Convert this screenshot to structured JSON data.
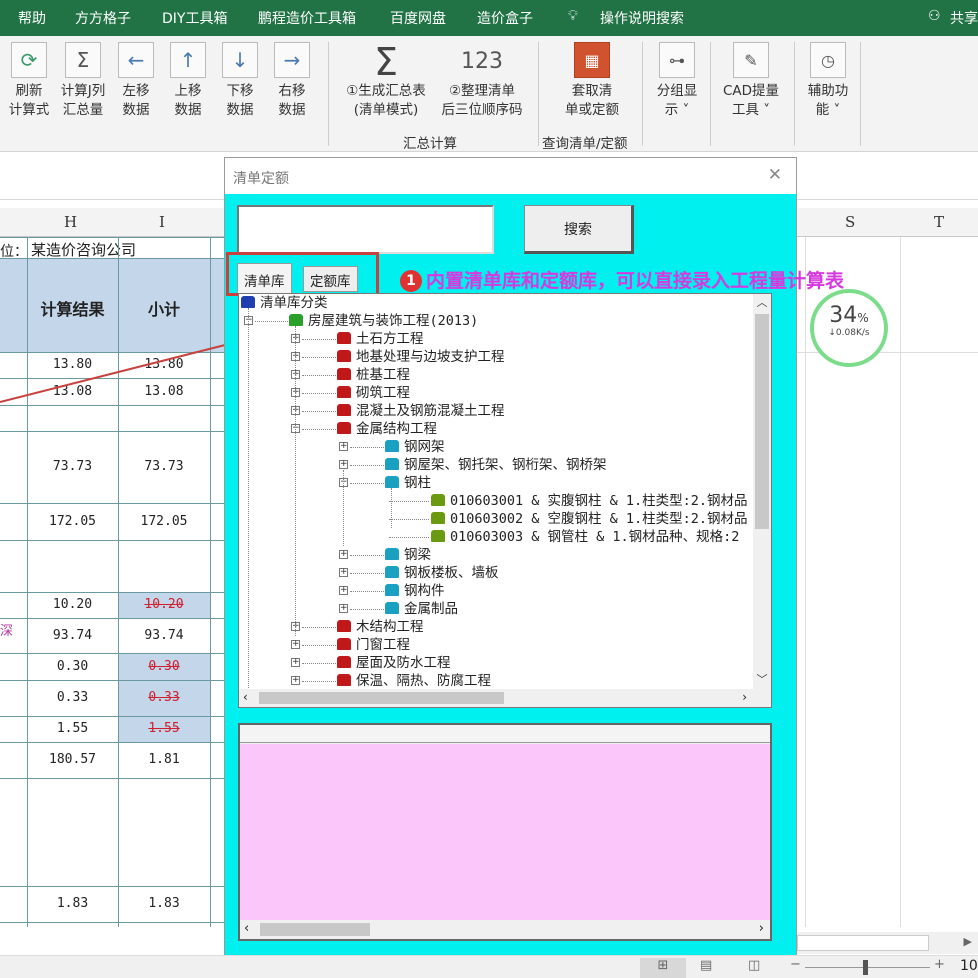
{
  "menu": [
    "帮助",
    "方方格子",
    "DIY工具箱",
    "鹏程造价工具箱",
    "百度网盘",
    "造价盒子"
  ],
  "tell_me": "操作说明搜索",
  "share": "共享",
  "ribbon": {
    "buttons": [
      {
        "l1": "刷新",
        "l2": "计算式",
        "icon": "refresh-icon"
      },
      {
        "l1": "计算J列",
        "l2": "汇总量",
        "icon": "sigma-grid-icon"
      },
      {
        "l1": "左移",
        "l2": "数据",
        "icon": "move-left-icon"
      },
      {
        "l1": "上移",
        "l2": "数据",
        "icon": "move-up-icon"
      },
      {
        "l1": "下移",
        "l2": "数据",
        "icon": "move-down-icon"
      },
      {
        "l1": "右移",
        "l2": "数据",
        "icon": "move-right-icon"
      }
    ],
    "sum1": {
      "l1": "①生成汇总表",
      "l2": "(清单模式)"
    },
    "sum2": {
      "l1": "②整理清单",
      "l2": "后三位顺序码",
      "glyph": "123"
    },
    "group_sum": "汇总计算",
    "query": {
      "l1": "套取清",
      "l2": "单或定额"
    },
    "group_query": "查询清单/定额",
    "group_display": {
      "l1": "分组显",
      "l2": "示 ˅"
    },
    "cad": {
      "l1": "CAD提量",
      "l2": "工具 ˅"
    },
    "aux": {
      "l1": "辅助功",
      "l2": "能 ˅"
    }
  },
  "sheet": {
    "columns": {
      "H": "H",
      "I": "I",
      "S": "S",
      "T": "T"
    },
    "row1_label": "位：",
    "company": "某造价咨询公司",
    "hdr_result": "计算结果",
    "hdr_subtotal": "小计",
    "side_note": "深",
    "rows": [
      {
        "h": "13.80",
        "i": "13.80"
      },
      {
        "h": "13.08",
        "i": "13.08"
      },
      {
        "h": "73.73",
        "i": "73.73"
      },
      {
        "h": "172.05",
        "i": "172.05"
      },
      {
        "h": "10.20",
        "i": "10.20",
        "strike": true
      },
      {
        "h": "93.74",
        "i": "93.74"
      },
      {
        "h": "0.30",
        "i": "0.30",
        "strike": true
      },
      {
        "h": "0.33",
        "i": "0.33",
        "strike": true
      },
      {
        "h": "1.55",
        "i": "1.55",
        "strike": true
      },
      {
        "h": "180.57",
        "i": "1.81"
      },
      {
        "h": "1.83",
        "i": "1.83"
      }
    ]
  },
  "speed": {
    "percent": "34",
    "unit": "%",
    "rate": "↓0.08K/s"
  },
  "dialog": {
    "title": "清单定额",
    "close": "✕",
    "search_value": "",
    "search_button": "搜索",
    "tabs": [
      "清单库",
      "定额库"
    ],
    "annotation_num": "1",
    "annotation": "内置清单库和定额库，可以直接录入工程量计算表",
    "tree": [
      {
        "t": "清单库分类",
        "lvl": 0,
        "c": "#1f3fb0"
      },
      {
        "t": "房屋建筑与装饰工程(2013)",
        "lvl": 1,
        "ex": "−",
        "c": "#2aa02a"
      },
      {
        "t": "土石方工程",
        "lvl": 2,
        "ex": "+",
        "c": "#c01818"
      },
      {
        "t": "地基处理与边坡支护工程",
        "lvl": 2,
        "ex": "+",
        "c": "#c01818"
      },
      {
        "t": "桩基工程",
        "lvl": 2,
        "ex": "+",
        "c": "#c01818"
      },
      {
        "t": "砌筑工程",
        "lvl": 2,
        "ex": "+",
        "c": "#c01818"
      },
      {
        "t": "混凝土及钢筋混凝土工程",
        "lvl": 2,
        "ex": "+",
        "c": "#c01818"
      },
      {
        "t": "金属结构工程",
        "lvl": 2,
        "ex": "−",
        "c": "#c01818"
      },
      {
        "t": "钢网架",
        "lvl": 3,
        "ex": "+",
        "c": "#1aa0c0"
      },
      {
        "t": "钢屋架、钢托架、钢桁架、钢桥架",
        "lvl": 3,
        "ex": "+",
        "c": "#1aa0c0"
      },
      {
        "t": "钢柱",
        "lvl": 3,
        "ex": "−",
        "c": "#1aa0c0"
      },
      {
        "t": "010603001 & 实腹钢柱 & 1.柱类型:2.钢材品",
        "lvl": 4,
        "c": "#6a9a10"
      },
      {
        "t": "010603002 & 空腹钢柱 & 1.柱类型:2.钢材品",
        "lvl": 4,
        "c": "#6a9a10"
      },
      {
        "t": "010603003 & 钢管柱 & 1.钢材品种、规格:2",
        "lvl": 4,
        "c": "#6a9a10"
      },
      {
        "t": "钢梁",
        "lvl": 3,
        "ex": "+",
        "c": "#1aa0c0"
      },
      {
        "t": "钢板楼板、墙板",
        "lvl": 3,
        "ex": "+",
        "c": "#1aa0c0"
      },
      {
        "t": "钢构件",
        "lvl": 3,
        "ex": "+",
        "c": "#1aa0c0"
      },
      {
        "t": "金属制品",
        "lvl": 3,
        "ex": "+",
        "c": "#1aa0c0"
      },
      {
        "t": "木结构工程",
        "lvl": 2,
        "ex": "+",
        "c": "#c01818"
      },
      {
        "t": "门窗工程",
        "lvl": 2,
        "ex": "+",
        "c": "#c01818"
      },
      {
        "t": "屋面及防水工程",
        "lvl": 2,
        "ex": "+",
        "c": "#c01818"
      },
      {
        "t": "保温、隔热、防腐工程",
        "lvl": 2,
        "ex": "+",
        "c": "#c01818"
      }
    ]
  },
  "status": {
    "zoom": "10"
  }
}
